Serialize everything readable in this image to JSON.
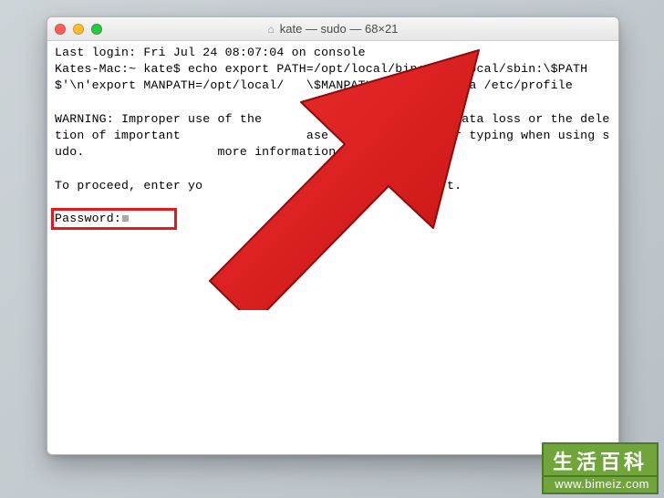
{
  "window": {
    "title": "kate — sudo — 68×21"
  },
  "terminal": {
    "last_login": "Last login: Fri Jul 24 08:07:04 on console",
    "command_line": "Kates-Mac:~ kate$ echo export PATH=/opt/local/bin:/opt/local/sbin:\\$PATH$'\\n'export MANPATH=/opt/local/   \\$MANPATH | sudo tee -a /etc/profile",
    "warning": "WARNING: Improper use of the                     d to data loss or the deletion of important                 ase double-check your typing when using sudo.                  more information.",
    "proceed": "To proceed, enter yo                        C to abort.",
    "password_label": "Password:"
  },
  "watermark": {
    "text": "生活百科",
    "url": "www.bimeiz.com"
  }
}
